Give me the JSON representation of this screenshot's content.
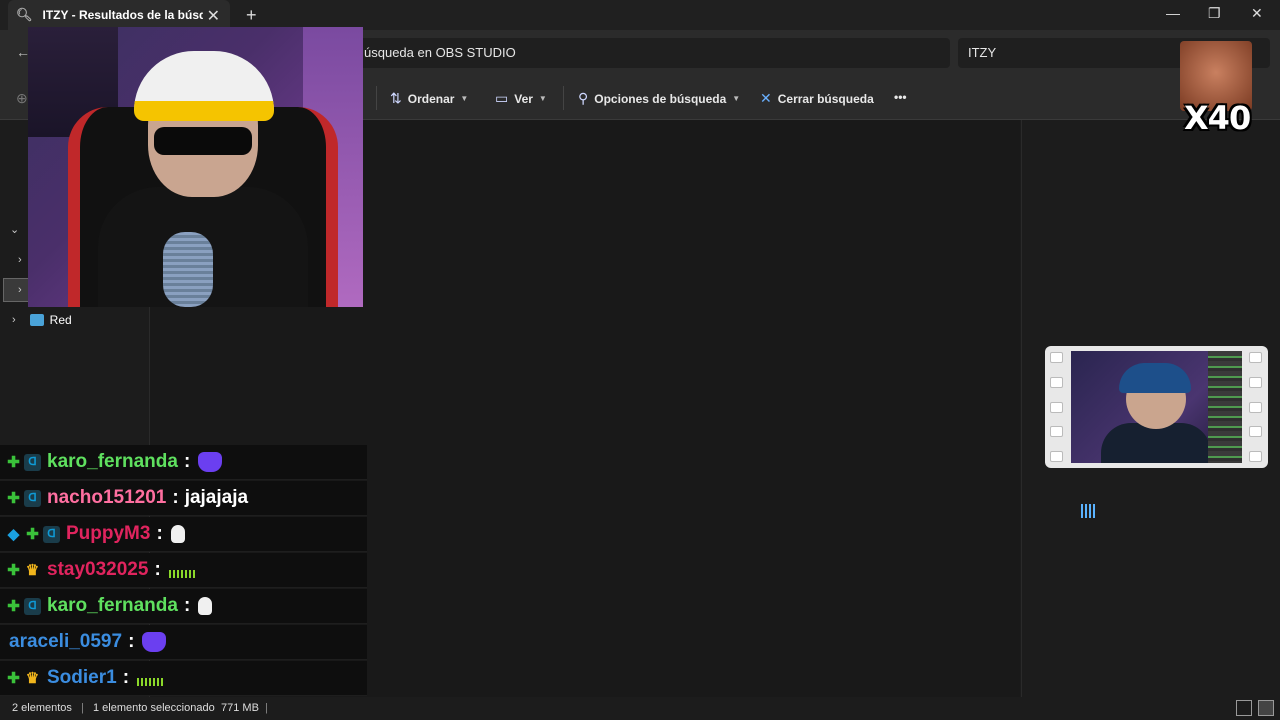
{
  "tab": {
    "title": "ITZY - Resultados de la búsq",
    "close": "✕",
    "new": "+"
  },
  "window": {
    "minimize": "—",
    "maximize": "❐",
    "close": "✕"
  },
  "address": {
    "text": "úsqueda en OBS STUDIO"
  },
  "search": {
    "value": "ITZY"
  },
  "toolbar": {
    "sort_label": "Ordenar",
    "view_label": "Ver",
    "search_options_label": "Opciones de búsqueda",
    "close_search_label": "Cerrar búsqueda",
    "more": "•••"
  },
  "nav": {
    "network_label": "Red"
  },
  "status": {
    "items": "2 elementos",
    "selected": "1 elemento seleccionado",
    "size": "771 MB"
  },
  "meme": {
    "count": "X40"
  },
  "chat": {
    "messages": [
      {
        "user": "karo_fernanda",
        "color": "#5fe05f",
        "sep": ":",
        "text": "",
        "emote": "purple",
        "badges": [
          "plus",
          "vip"
        ]
      },
      {
        "user": "nacho151201",
        "color": "#ff6fa0",
        "sep": ":",
        "text": "jajajaja",
        "emote": "",
        "badges": [
          "plus",
          "vip"
        ]
      },
      {
        "user": "PuppyM3",
        "color": "#e0245e",
        "sep": ":",
        "text": "",
        "emote": "goose",
        "badges": [
          "cube",
          "plus",
          "vip"
        ]
      },
      {
        "user": "stay032025",
        "color": "#e0245e",
        "sep": ":",
        "text": "",
        "emote": "bars",
        "badges": [
          "plus",
          "crown"
        ]
      },
      {
        "user": "karo_fernanda",
        "color": "#5fe05f",
        "sep": ":",
        "text": "",
        "emote": "goose",
        "badges": [
          "plus",
          "vip"
        ]
      },
      {
        "user": "araceli_0597",
        "color": "#3b8de0",
        "sep": ":",
        "text": "",
        "emote": "purple",
        "badges": []
      },
      {
        "user": "Sodier1",
        "color": "#3b8de0",
        "sep": ":",
        "text": "",
        "emote": "bars",
        "badges": [
          "plus",
          "crown"
        ]
      }
    ]
  },
  "icons": {
    "search_tab": "magnifier-icon",
    "sort": "sort-arrows-icon",
    "view": "monitor-icon",
    "search_options": "search-person-icon",
    "close_search": "x-icon",
    "network": "network-icon"
  }
}
